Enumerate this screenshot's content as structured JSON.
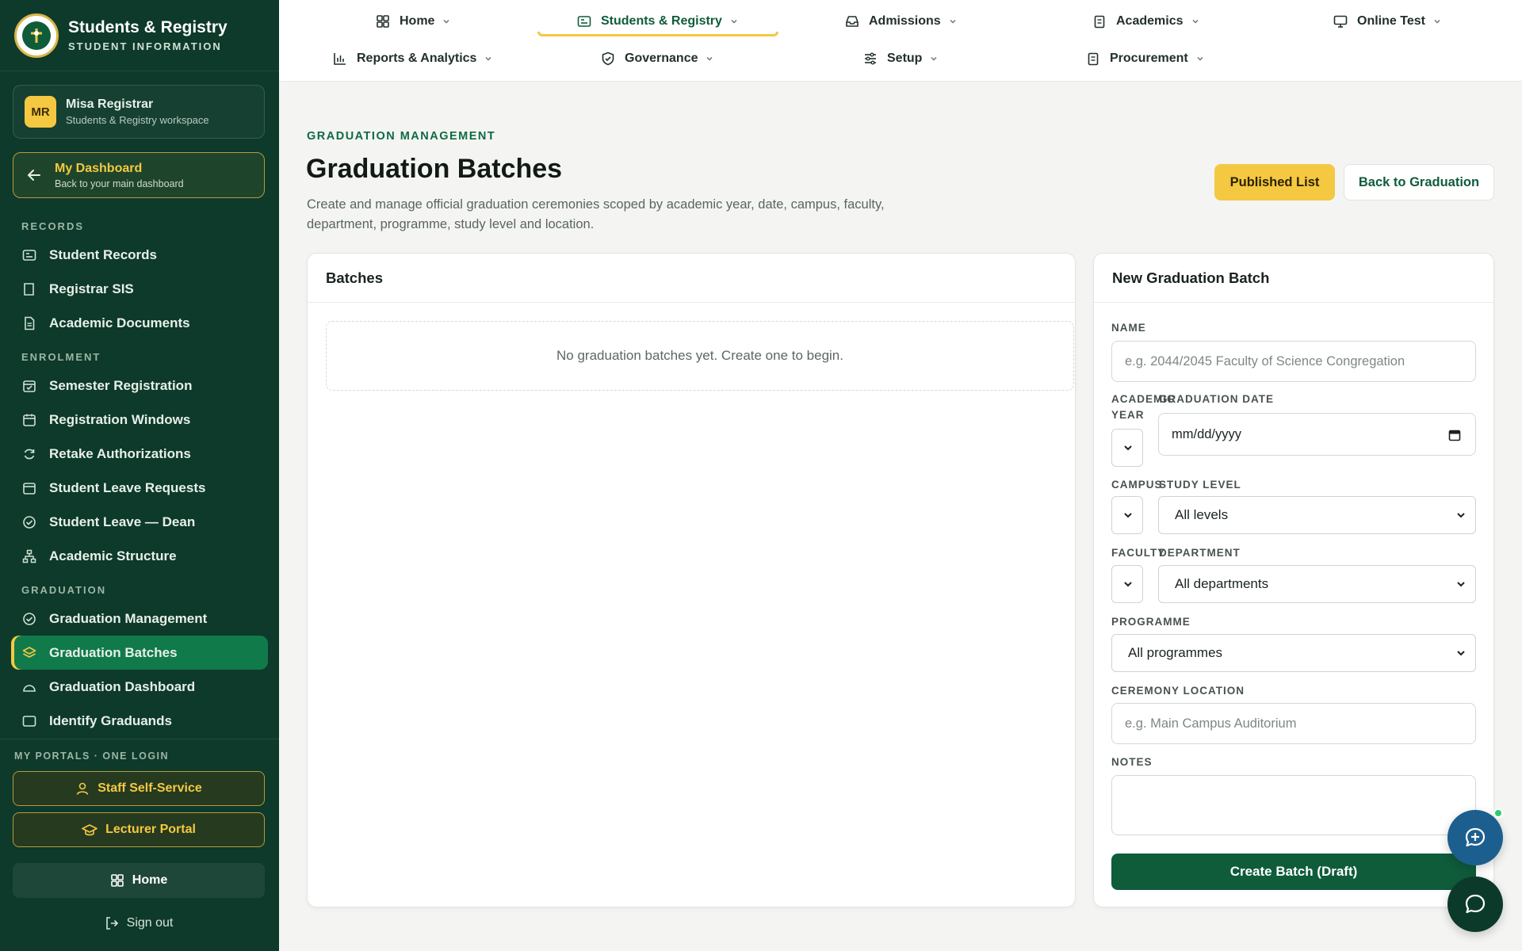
{
  "brand": {
    "title": "Students & Registry",
    "subtitle": "STUDENT INFORMATION"
  },
  "user": {
    "initials": "MR",
    "name": "Misa Registrar",
    "workspace": "Students & Registry workspace"
  },
  "dashboard": {
    "title": "My Dashboard",
    "subtitle": "Back to your main dashboard"
  },
  "sidebar": {
    "sections": [
      {
        "label": "RECORDS",
        "items": [
          "Student Records",
          "Registrar SIS",
          "Academic Documents"
        ]
      },
      {
        "label": "ENROLMENT",
        "items": [
          "Semester Registration",
          "Registration Windows",
          "Retake Authorizations",
          "Student Leave Requests",
          "Student Leave — Dean",
          "Academic Structure"
        ]
      },
      {
        "label": "GRADUATION",
        "items": [
          "Graduation Management",
          "Graduation Batches",
          "Graduation Dashboard",
          "Identify Graduands"
        ]
      }
    ],
    "active_item": "Graduation Batches"
  },
  "portals": {
    "label": "MY PORTALS · ONE LOGIN",
    "staff": "Staff Self-Service",
    "lecturer": "Lecturer Portal",
    "home": "Home",
    "signout": "Sign out"
  },
  "topnav": {
    "row1": [
      "Home",
      "Students & Registry",
      "Admissions",
      "Academics",
      "Online Test"
    ],
    "row2": [
      "Reports & Analytics",
      "Governance",
      "Setup",
      "Procurement"
    ],
    "active": "Students & Registry"
  },
  "page": {
    "eyebrow": "GRADUATION MANAGEMENT",
    "title": "Graduation Batches",
    "description": "Create and manage official graduation ceremonies scoped by academic year, date, campus, faculty, department, programme, study level and location.",
    "published_label": "Published List",
    "back_label": "Back to Graduation"
  },
  "batches": {
    "title": "Batches",
    "empty": "No graduation batches yet. Create one to begin."
  },
  "form": {
    "title": "New Graduation Batch",
    "name_label": "NAME",
    "name_placeholder": "e.g. 2044/2045 Faculty of Science Congregation",
    "academic_year_label": "ACADEMIC YEAR",
    "graduation_date_label": "GRADUATION DATE",
    "graduation_date_placeholder": "mm/dd/yyyy",
    "campus_label": "CAMPUS",
    "study_level_label": "STUDY LEVEL",
    "study_level_value": "All levels",
    "faculty_label": "FACULTY",
    "department_label": "DEPARTMENT",
    "department_value": "All departments",
    "programme_label": "PROGRAMME",
    "programme_value": "All programmes",
    "location_label": "CEREMONY LOCATION",
    "location_placeholder": "e.g. Main Campus Auditorium",
    "notes_label": "NOTES",
    "submit_label": "Create Batch (Draft)"
  },
  "colors": {
    "sidebar_bg": "#0d3a2a",
    "accent_gold": "#f5c842",
    "primary_green": "#0f5c3b",
    "active_item": "#117a4a"
  }
}
